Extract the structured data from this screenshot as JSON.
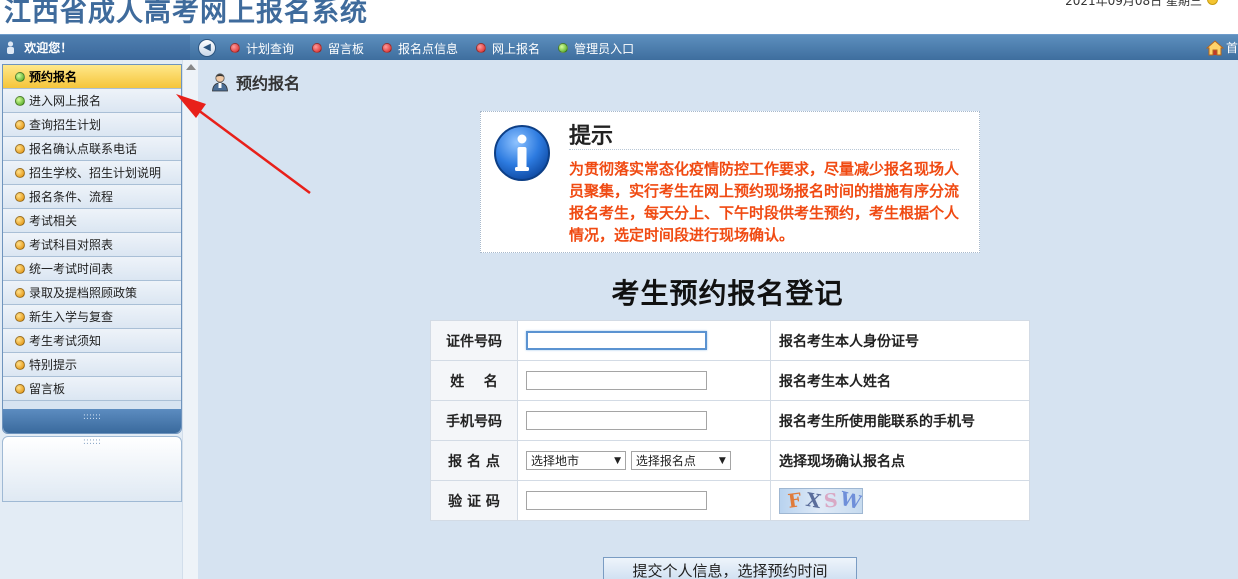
{
  "header": {
    "site_title": "江西省成人高考网上报名系统",
    "date_text": "2021年09月08日 星期三",
    "extra_text": "…"
  },
  "navbar": {
    "welcome": "欢迎您！",
    "items": [
      {
        "label": "计划查询",
        "dot_color": "red"
      },
      {
        "label": "留言板",
        "dot_color": "red"
      },
      {
        "label": "报名点信息",
        "dot_color": "red"
      },
      {
        "label": "网上报名",
        "dot_color": "red"
      },
      {
        "label": "管理员入口",
        "dot_color": "green"
      }
    ],
    "home_label": "首"
  },
  "sidebar": {
    "items": [
      {
        "label": "预约报名",
        "dot_color": "green"
      },
      {
        "label": "进入网上报名",
        "dot_color": "green"
      },
      {
        "label": "查询招生计划",
        "dot_color": "orange"
      },
      {
        "label": "报名确认点联系电话",
        "dot_color": "orange"
      },
      {
        "label": "招生学校、招生计划说明",
        "dot_color": "orange"
      },
      {
        "label": "报名条件、流程",
        "dot_color": "orange"
      },
      {
        "label": "考试相关",
        "dot_color": "orange"
      },
      {
        "label": "考试科目对照表",
        "dot_color": "orange"
      },
      {
        "label": "统一考试时间表",
        "dot_color": "orange"
      },
      {
        "label": "录取及提档照顾政策",
        "dot_color": "orange"
      },
      {
        "label": "新生入学与复查",
        "dot_color": "orange"
      },
      {
        "label": "考生考试须知",
        "dot_color": "orange"
      },
      {
        "label": "特别提示",
        "dot_color": "orange"
      },
      {
        "label": "留言板",
        "dot_color": "orange"
      }
    ]
  },
  "main": {
    "page_title": "预约报名",
    "notice": {
      "title": "提示",
      "text": "为贯彻落实常态化疫情防控工作要求，尽量减少报名现场人员聚集，实行考生在网上预约现场报名时间的措施有序分流报名考生，每天分上、下午时段供考生预约，考生根据个人情况，选定时间段进行现场确认。"
    },
    "form_title": "考生预约报名登记",
    "form": {
      "id_label": "证件号码",
      "id_value": "",
      "id_hint": "报名考生本人身份证号",
      "name_label": "姓    名",
      "name_value": "",
      "name_hint": "报名考生本人姓名",
      "phone_label": "手机号码",
      "phone_value": "",
      "phone_hint": "报名考生所使用能联系的手机号",
      "site_label": "报 名 点",
      "city_select": "选择地市",
      "site_select": "选择报名点",
      "site_hint": "选择现场确认报名点",
      "captcha_label": "验 证 码",
      "captcha_value": "",
      "captcha_text": "FXSW"
    },
    "submit_label": "提交个人信息，选择预约时间"
  },
  "colors": {
    "nav_bg": "#4a7cae",
    "active_item": "#f5c53a",
    "notice_text": "#f04a12",
    "annotation_arrow": "#e8201a"
  }
}
